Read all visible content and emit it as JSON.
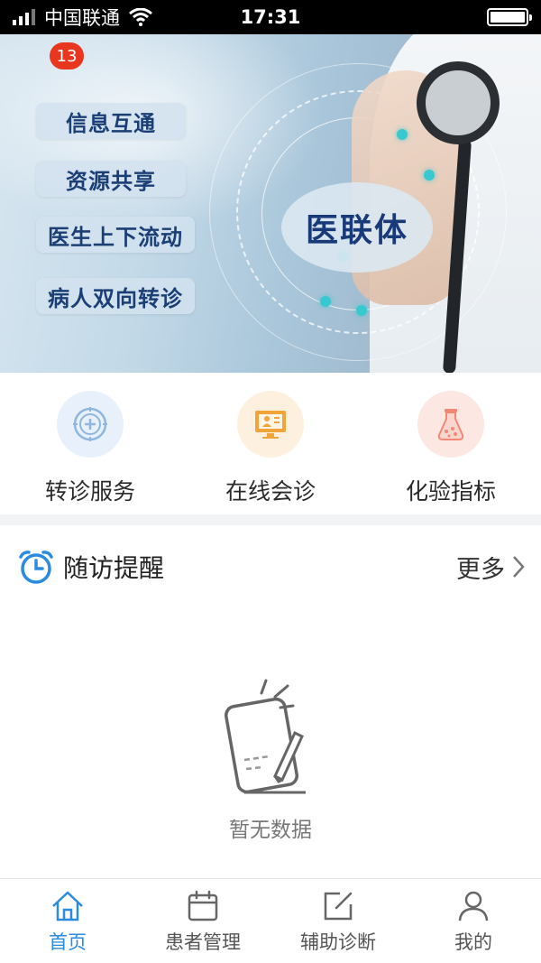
{
  "status_bar": {
    "carrier": "中国联通",
    "time": "17:31"
  },
  "banner": {
    "badge_count": "13",
    "pills": [
      "信息互通",
      "资源共享",
      "医生上下流动",
      "病人双向转诊"
    ],
    "center_title": "医联体"
  },
  "quick_services": [
    {
      "label": "转诊服务",
      "icon": "referral-target-icon"
    },
    {
      "label": "在线会诊",
      "icon": "monitor-consult-icon"
    },
    {
      "label": "化验指标",
      "icon": "lab-flask-icon"
    }
  ],
  "followup": {
    "title": "随访提醒",
    "more_label": "更多",
    "empty_text": "暂无数据"
  },
  "tabbar": {
    "tabs": [
      {
        "label": "首页",
        "icon": "home-icon",
        "active": true
      },
      {
        "label": "患者管理",
        "icon": "calendar-icon",
        "active": false
      },
      {
        "label": "辅助诊断",
        "icon": "edit-icon",
        "active": false
      },
      {
        "label": "我的",
        "icon": "user-icon",
        "active": false
      }
    ]
  },
  "colors": {
    "accent": "#2a8be0",
    "badge": "#e8361f",
    "pill_text": "#1b3f75"
  }
}
